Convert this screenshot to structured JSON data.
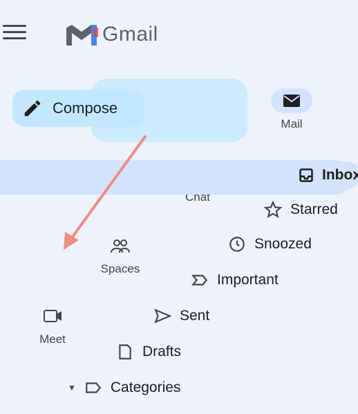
{
  "app": {
    "logo_text": "Gmail"
  },
  "compose": {
    "label": "Compose"
  },
  "rail": {
    "items": [
      {
        "label": "Mail",
        "icon": "mail-icon"
      },
      {
        "label": "Chat",
        "icon": "chat-icon"
      },
      {
        "label": "Spaces",
        "icon": "spaces-icon"
      },
      {
        "label": "Meet",
        "icon": "meet-icon"
      }
    ]
  },
  "nav": {
    "items": [
      {
        "label": "Inbox",
        "icon": "inbox-icon",
        "active": true
      },
      {
        "label": "Starred",
        "icon": "star-icon"
      },
      {
        "label": "Snoozed",
        "icon": "clock-icon"
      },
      {
        "label": "Important",
        "icon": "important-icon"
      },
      {
        "label": "Sent",
        "icon": "send-icon"
      },
      {
        "label": "Drafts",
        "icon": "draft-icon"
      },
      {
        "label": "Categories",
        "icon": "label-icon"
      }
    ]
  },
  "colors": {
    "highlight": "#c2e7ff",
    "active": "#d3e3fd",
    "arrow": "#f28b82"
  }
}
